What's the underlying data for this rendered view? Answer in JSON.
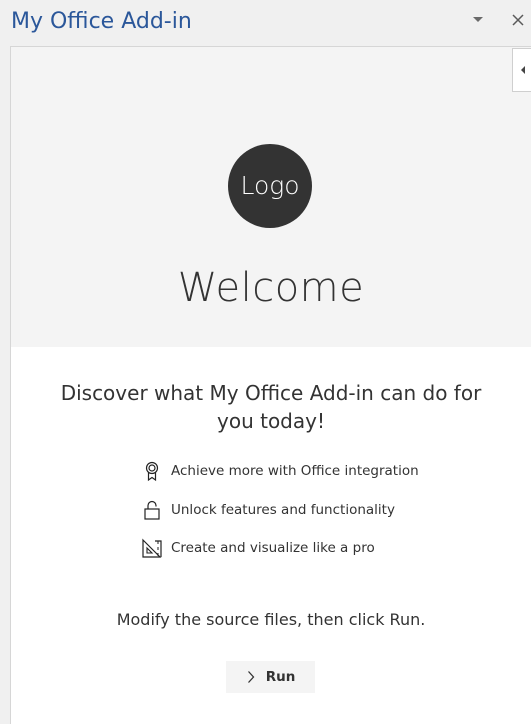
{
  "taskpane": {
    "title": "My Office Add-in"
  },
  "header": {
    "logo_text": "Logo",
    "welcome": "Welcome"
  },
  "main": {
    "heading": "Discover what My Office Add-in can do for you today!",
    "features": [
      {
        "icon": "ribbon-icon",
        "text": "Achieve more with Office integration"
      },
      {
        "icon": "unlock-icon",
        "text": "Unlock features and functionality"
      },
      {
        "icon": "design-icon",
        "text": "Create and visualize like a pro"
      }
    ],
    "instructions": "Modify the source files, then click Run.",
    "run_button_label": "Run"
  }
}
